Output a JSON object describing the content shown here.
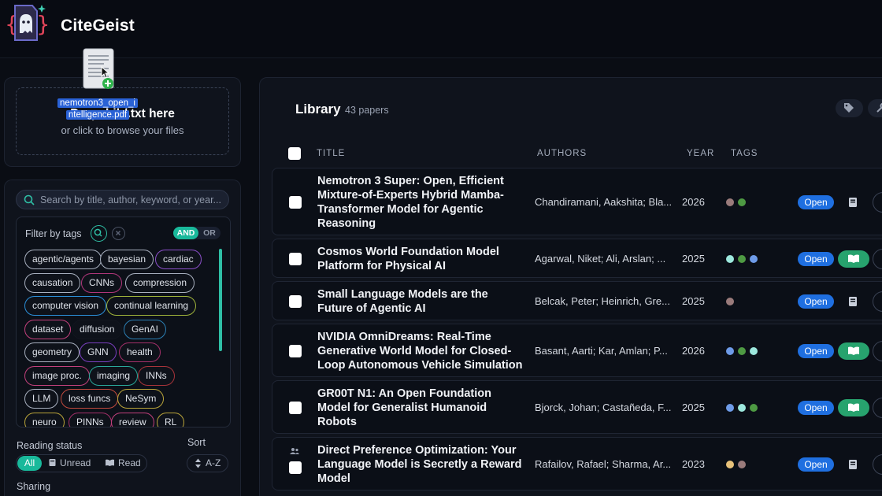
{
  "app": {
    "title": "CiteGeist"
  },
  "upload": {
    "title": "Drop .bib/.txt here",
    "subtitle": "or click to browse your files",
    "drag_file": "nemotron3_open_intelligence.pdf",
    "drag_file_line1": "nemotron3_open_i",
    "drag_file_line2": "ntelligence.pdf"
  },
  "search": {
    "placeholder": "Search by title, author, keyword, or year..."
  },
  "tag_filter": {
    "title": "Filter by tags",
    "and_label": "AND",
    "or_label": "OR",
    "tags": [
      {
        "label": "agentic/agents",
        "color": "#a8b0bf"
      },
      {
        "label": "bayesian",
        "color": "#a8b0bf"
      },
      {
        "label": "cardiac",
        "color": "#8b4fc9"
      },
      {
        "label": "causation",
        "color": "#a8b0bf"
      },
      {
        "label": "CNNs",
        "color": "#b0367a"
      },
      {
        "label": "compression",
        "color": "#a8b0bf"
      },
      {
        "label": "computer vision",
        "color": "#2b8fd8"
      },
      {
        "label": "continual learning",
        "color": "#9fb33a"
      },
      {
        "label": "dataset",
        "color": "#c2407c"
      },
      {
        "label": "diffusion",
        "color": "#12161f"
      },
      {
        "label": "GenAI",
        "color": "#2b7fb4"
      },
      {
        "label": "geometry",
        "color": "#a8b0bf"
      },
      {
        "label": "GNN",
        "color": "#7a3fbf"
      },
      {
        "label": "health",
        "color": "#a4306a"
      },
      {
        "label": "image proc.",
        "color": "#c2407c"
      },
      {
        "label": "imaging",
        "color": "#2aa89a"
      },
      {
        "label": "INNs",
        "color": "#a8343a"
      },
      {
        "label": "LLM",
        "color": "#a8b0bf"
      },
      {
        "label": "loss funcs",
        "color": "#c24a3e"
      },
      {
        "label": "NeSym",
        "color": "#b9a43a"
      },
      {
        "label": "neuro",
        "color": "#b9a43a"
      },
      {
        "label": "PINNs",
        "color": "#a4306a"
      },
      {
        "label": "review",
        "color": "#c2407c"
      },
      {
        "label": "RL",
        "color": "#b9a43a"
      }
    ]
  },
  "reading_status": {
    "title": "Reading status",
    "options": [
      "All",
      "Unread",
      "Read"
    ],
    "selected": "All"
  },
  "sort": {
    "title": "Sort",
    "value": "A-Z"
  },
  "sharing": {
    "title": "Sharing"
  },
  "library": {
    "title": "Library",
    "count": "43 papers",
    "columns": [
      "TITLE",
      "AUTHORS",
      "YEAR",
      "TAGS"
    ],
    "open_label": "Open",
    "rows": [
      {
        "title": "Nemotron 3 Super: Open, Efficient Mixture-of-Experts Hybrid Mamba-Transformer Model for Agentic Reasoning",
        "authors": "Chandiramani, Aakshita; Bla...",
        "year": "2026",
        "tag_colors": [
          "#9a7b7b",
          "#4e9a43"
        ],
        "read": false,
        "shared": false
      },
      {
        "title": "Cosmos World Foundation Model Platform for Physical AI",
        "authors": "Agarwal, Niket; Ali, Arslan; ...",
        "year": "2025",
        "tag_colors": [
          "#9de8dd",
          "#4e9a43",
          "#6e9be8"
        ],
        "read": true,
        "shared": false
      },
      {
        "title": "Small Language Models are the Future of Agentic AI",
        "authors": "Belcak, Peter; Heinrich, Gre...",
        "year": "2025",
        "tag_colors": [
          "#9a7b7b"
        ],
        "read": false,
        "shared": false
      },
      {
        "title": "NVIDIA OmniDreams: Real-Time Generative World Model for Closed-Loop Autonomous Vehicle Simulation",
        "authors": "Basant, Aarti; Kar, Amlan; P...",
        "year": "2026",
        "tag_colors": [
          "#6e9be8",
          "#4e9a43",
          "#9de8dd"
        ],
        "read": true,
        "shared": false
      },
      {
        "title": "GR00T N1: An Open Foundation Model for Generalist Humanoid Robots",
        "authors": "Bjorck, Johan; Castañeda, F...",
        "year": "2025",
        "tag_colors": [
          "#6e9be8",
          "#9de8dd",
          "#4e9a43"
        ],
        "read": true,
        "shared": false
      },
      {
        "title": "Direct Preference Optimization: Your Language Model is Secretly a Reward Model",
        "authors": "Rafailov, Rafael; Sharma, Ar...",
        "year": "2023",
        "tag_colors": [
          "#e8c27a",
          "#9a7b7b"
        ],
        "read": false,
        "shared": true
      }
    ]
  }
}
